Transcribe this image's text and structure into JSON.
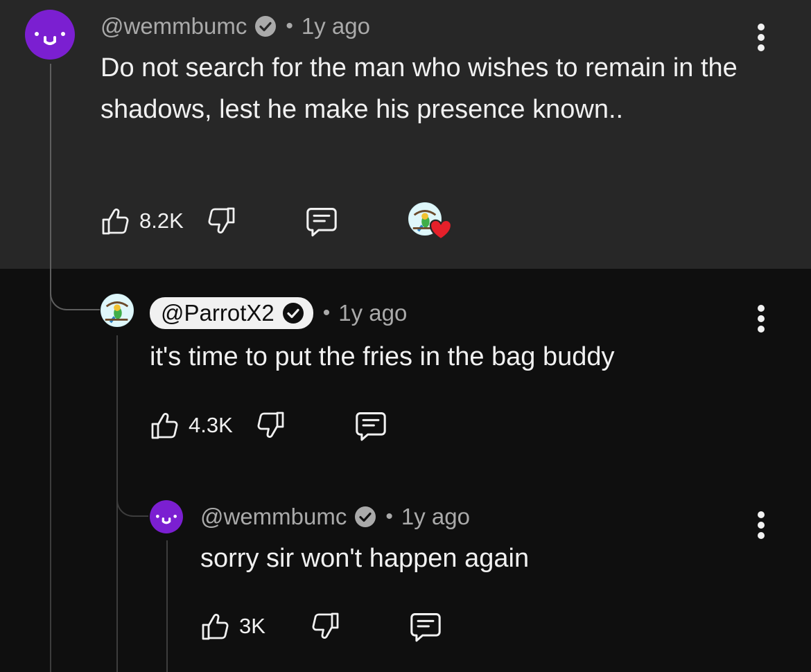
{
  "colors": {
    "top_panel_bg": "#272727",
    "page_bg": "#0f0f0f",
    "text": "#f1f1f1",
    "muted": "#aaaaaa",
    "avatar_purple": "#7b1fd1",
    "heart": "#e5202a"
  },
  "comments": [
    {
      "handle": "@wemmbumc",
      "verified": true,
      "separator": "•",
      "time": "1y ago",
      "text": "Do not search for the man who wishes to remain in the shadows, lest he make his presence known..",
      "likes": "8.2K",
      "avatar_icon": "smiley-avatar-icon",
      "creator_heart": true
    },
    {
      "handle": "@ParrotX2",
      "verified": true,
      "separator": "•",
      "time": "1y ago",
      "text": "it's time to put the fries in the bag buddy",
      "likes": "4.3K",
      "avatar_icon": "parrot-avatar-icon"
    },
    {
      "handle": "@wemmbumc",
      "verified": true,
      "separator": "•",
      "time": "1y ago",
      "text": "sorry sir won't happen again",
      "likes": "3K",
      "avatar_icon": "smiley-avatar-icon"
    }
  ],
  "icons": {
    "like": "thumbs-up-icon",
    "dislike": "thumbs-down-icon",
    "reply": "reply-comment-icon",
    "more": "more-vert-icon",
    "verified": "verified-check-icon",
    "heart": "heart-icon"
  }
}
